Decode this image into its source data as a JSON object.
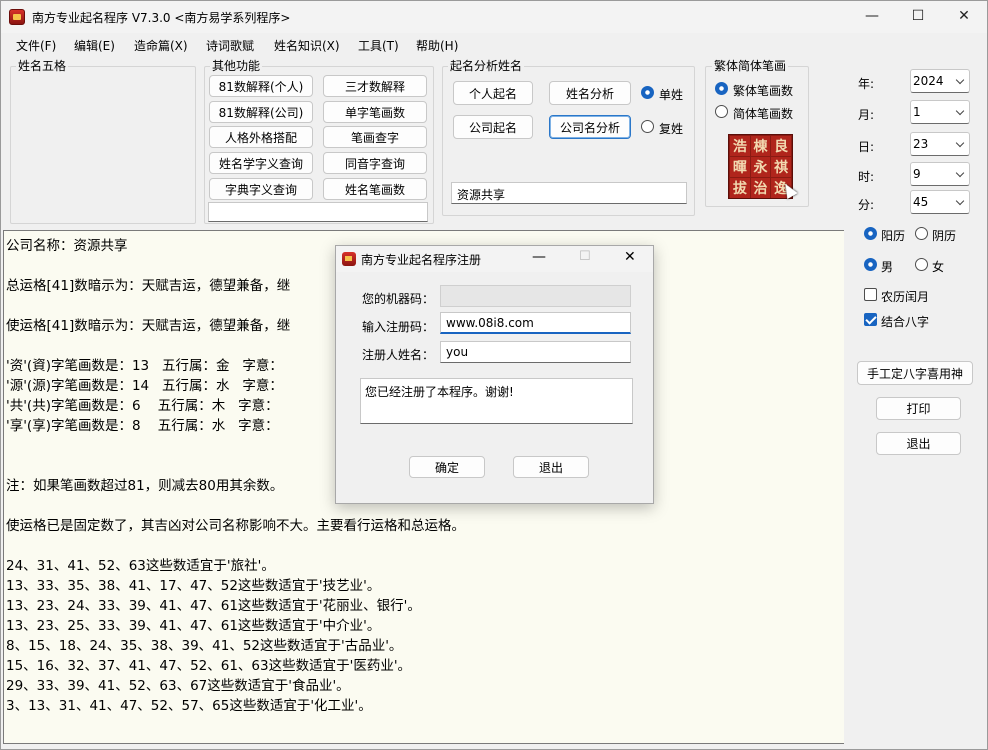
{
  "window": {
    "title": "南方专业起名程序 V7.3.0  <南方易学系列程序>",
    "controls": {
      "minimize": "—",
      "maximize": "☐",
      "close": "✕"
    }
  },
  "menu": [
    "文件(F)",
    "编辑(E)",
    "造命篇(X)",
    "诗词歌赋",
    "姓名知识(X)",
    "工具(T)",
    "帮助(H)"
  ],
  "groups": {
    "wuge": {
      "label": "姓名五格"
    },
    "other": {
      "label": "其他功能",
      "buttons": [
        "81数解释(个人)",
        "三才数解释",
        "81数解释(公司)",
        "单字笔画数",
        "人格外格搭配",
        "笔画查字",
        "姓名学字义查询",
        "同音字查询",
        "字典字义查询",
        "姓名笔画数"
      ],
      "input_value": ""
    },
    "analysis": {
      "label": "起名分析姓名",
      "buttons": [
        "个人起名",
        "姓名分析",
        "公司起名",
        "公司名分析"
      ],
      "radios": [
        "单姓",
        "复姓"
      ],
      "input_value": "资源共享"
    },
    "stroke": {
      "label": "繁体简体笔画",
      "radios": [
        "繁体笔画数",
        "简体笔画数"
      ],
      "seal_chars": [
        "浩",
        "棟",
        "良",
        "暉",
        "永",
        "祺",
        "拔",
        "治",
        "逸"
      ]
    }
  },
  "datetime": {
    "year_label": "年:",
    "year": "2024",
    "month_label": "月:",
    "month": "1",
    "day_label": "日:",
    "day": "23",
    "hour_label": "时:",
    "hour": "9",
    "minute_label": "分:",
    "minute": "45"
  },
  "calendar_radios": [
    "阳历",
    "阴历"
  ],
  "gender_radios": [
    "男",
    "女"
  ],
  "checkboxes": [
    {
      "label": "农历闰月",
      "checked": false
    },
    {
      "label": "结合八字",
      "checked": true
    }
  ],
  "right_buttons": [
    "手工定八字喜用神",
    "打印",
    "退出"
  ],
  "output_lines": [
    "公司名称：资源共享",
    "",
    "总运格[41]数暗示为：天赋吉运，德望兼备，继",
    "",
    "使运格[41]数暗示为：天赋吉运，德望兼备，继",
    "",
    "'资'(資)字笔画数是：13   五行属：金   字意：                                       环境良好，秀气之字。",
    "'源'(源)字笔画数是：14   五行属：水   字意：                                       富贵之字。",
    "'共'(共)字笔画数是：6    五行属：木   字意：                                       成功隆昌。",
    "'享'(享)字笔画数是：8    五行属：水   字意：                                       兴隆昌。",
    "",
    "",
    "注：如果笔画数超过81，则减去80用其余数。",
    "",
    "使运格已是固定数了，其吉凶对公司名称影响不大。主要看行运格和总运格。",
    "",
    "24、31、41、52、63这些数适宜于'旅社'。",
    "13、33、35、38、41、17、47、52这些数适宜于'技艺业'。",
    "13、23、24、33、39、41、47、61这些数适宜于'花丽业、银行'。",
    "13、23、25、33、39、41、47、61这些数适宜于'中介业'。",
    "8、15、18、24、35、38、39、41、52这些数适宜于'古品业'。",
    "15、16、32、37、41、47、52、61、63这些数适宜于'医药业'。",
    "29、33、39、41、52、63、67这些数适宜于'食品业'。",
    "3、13、31、41、47、52、57、65这些数适宜于'化工业'。"
  ],
  "dialog": {
    "title": "南方专业起名程序注册",
    "machine_code_label": "您的机器码：",
    "machine_code_value": "",
    "reg_code_label": "输入注册码：",
    "reg_code_value": "www.08i8.com",
    "name_label": "注册人姓名：",
    "name_value": "you",
    "message": "您已经注册了本程序。谢谢!",
    "ok_label": "确定",
    "exit_label": "退出"
  }
}
